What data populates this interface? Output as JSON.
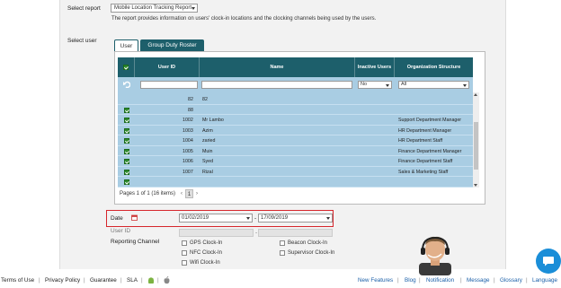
{
  "report": {
    "label": "Select report",
    "selected": "Mobile Location Tracking Report",
    "description": "The report provides information on users' clock-in locations and the clocking channels being used by the users."
  },
  "user_select": {
    "label": "Select user",
    "tabs": [
      {
        "label": "User"
      },
      {
        "label": "Group Duty Roster"
      }
    ]
  },
  "grid": {
    "headers": {
      "user_id": "User ID",
      "name": "Name",
      "inactive": "Inactive Users",
      "org": "Organization Structure"
    },
    "filters": {
      "inactive": "No",
      "org": "All"
    },
    "rows": [
      {
        "id": "82",
        "name": "82",
        "org": ""
      },
      {
        "id": "88",
        "name": "",
        "org": ""
      },
      {
        "id": "1002",
        "name": "Mr Lambo",
        "org": "Support Department Manager"
      },
      {
        "id": "1003",
        "name": "Azim",
        "org": "HR Department Manager"
      },
      {
        "id": "1004",
        "name": "zaried",
        "org": "HR Department Staff"
      },
      {
        "id": "1005",
        "name": "Muin",
        "org": "Finance Department Manager"
      },
      {
        "id": "1006",
        "name": "Syed",
        "org": "Finance Department Staff"
      },
      {
        "id": "1007",
        "name": "Rizal",
        "org": "Sales & Marketing Staff"
      }
    ],
    "pager_text": "Pages 1 of 1 (16 items)",
    "prev": "‹",
    "page": "1",
    "next": "›"
  },
  "date": {
    "label": "Date",
    "from": "01/02/2019",
    "to": "17/09/2019",
    "separator": "-"
  },
  "user_id_label": "User ID",
  "user_id_separator": "-",
  "reporting": {
    "label": "Reporting Channel",
    "options": [
      {
        "label": "GPS Clock-In"
      },
      {
        "label": "Beacon Clock-In"
      },
      {
        "label": "NFC Clock-In"
      },
      {
        "label": "Supervisor Clock-In"
      },
      {
        "label": "Wifi Clock-In"
      }
    ]
  },
  "footer": {
    "left": [
      "Terms of Use",
      "Privacy Policy",
      "Guarantee",
      "SLA"
    ],
    "right": [
      "New Features",
      "Blog",
      "Notification",
      "Message",
      "Glossary",
      "Language"
    ]
  },
  "colors": {
    "header": "#1d5f6b",
    "row": "#a9cde3",
    "highlight": "#d6262c",
    "link": "#1a5fa8"
  }
}
